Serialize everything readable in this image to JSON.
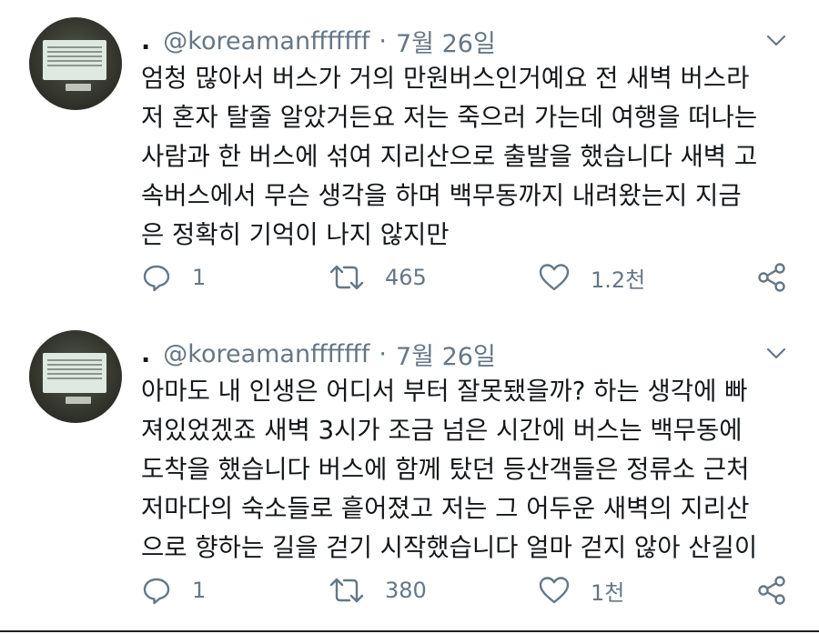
{
  "colors": {
    "text": "#14171a",
    "muted": "#657786",
    "background": "#ffffff"
  },
  "tweets": [
    {
      "author": {
        "dot": ".",
        "handle": "@koreamanfffffff",
        "separator": "·",
        "date": "7월 26일",
        "avatar_icon": "avatar-photo"
      },
      "lines": [
        "엄청 많아서 버스가 거의 만원버스인거예요 전 새벽 버스라",
        "저 혼자 탈줄 알았거든요 저는 죽으러 가는데 여행을 떠나는",
        "사람과 한 버스에 섞여 지리산으로 출발을 했습니다 새벽 고",
        "속버스에서 무슨 생각을 하며 백무동까지 내려왔는지 지금",
        "은 정확히 기억이 나지 않지만"
      ],
      "stats": {
        "replies": "1",
        "retweets": "465",
        "likes": "1.2천"
      }
    },
    {
      "author": {
        "dot": ".",
        "handle": "@koreamanfffffff",
        "separator": "·",
        "date": "7월 26일",
        "avatar_icon": "avatar-photo"
      },
      "lines": [
        "아마도 내 인생은 어디서 부터 잘못됐을까? 하는 생각에 빠",
        "져있었겠죠 새벽 3시가 조금 넘은 시간에 버스는 백무동에",
        "도착을 했습니다 버스에 함께 탔던 등산객들은 정류소 근처",
        "저마다의 숙소들로 흩어졌고 저는 그 어두운 새벽의 지리산",
        "으로 향하는 길을 걷기 시작했습니다 얼마 걷지 않아 산길이"
      ],
      "stats": {
        "replies": "1",
        "retweets": "380",
        "likes": "1천"
      }
    }
  ]
}
